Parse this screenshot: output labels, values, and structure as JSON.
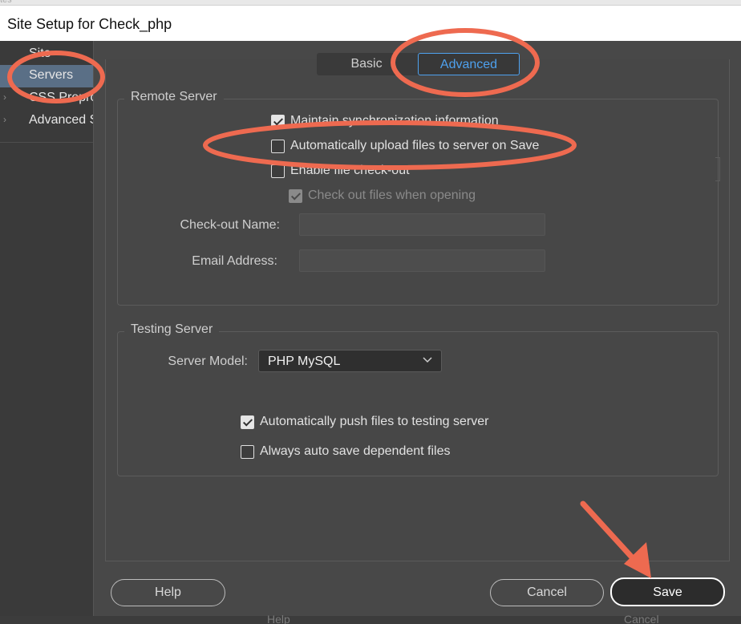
{
  "window": {
    "title": "Site Setup for Check_php",
    "top_fragment": "tes"
  },
  "sidebar": {
    "items": [
      {
        "label": "Site",
        "selected": false,
        "expandable": false
      },
      {
        "label": "Servers",
        "selected": true,
        "expandable": false
      },
      {
        "label": "CSS Preprocessors",
        "selected": false,
        "expandable": true
      },
      {
        "label": "Advanced Settings",
        "selected": false,
        "expandable": true
      }
    ]
  },
  "tabs": {
    "basic": "Basic",
    "advanced": "Advanced",
    "active": "Advanced"
  },
  "remote_server": {
    "legend": "Remote Server",
    "maintain_sync": {
      "label": "Maintain synchronization information",
      "checked": true
    },
    "auto_upload": {
      "label": "Automatically upload files to server on Save",
      "checked": false
    },
    "enable_checkout": {
      "label": "Enable file check-out",
      "checked": false
    },
    "checkout_when_opening": {
      "label": "Check out files when opening",
      "checked": true,
      "disabled": true
    },
    "checkout_name_label": "Check-out Name:",
    "checkout_name_value": "",
    "email_label": "Email Address:",
    "email_value": ""
  },
  "testing_server": {
    "legend": "Testing Server",
    "server_model_label": "Server Model:",
    "server_model_value": "PHP MySQL",
    "auto_push": {
      "label": "Automatically push files to testing server",
      "checked": true
    },
    "auto_save_dependent": {
      "label": "Always auto save dependent files",
      "checked": false
    }
  },
  "buttons": {
    "help": "Help",
    "cancel": "Cancel",
    "save": "Save"
  },
  "ghost_buttons": {
    "help": "Help",
    "cancel": "Cancel"
  },
  "colors": {
    "accent_blue": "#4ea1ee",
    "annotation_orange": "#ee6a50",
    "selected_item": "#5a6f86"
  }
}
